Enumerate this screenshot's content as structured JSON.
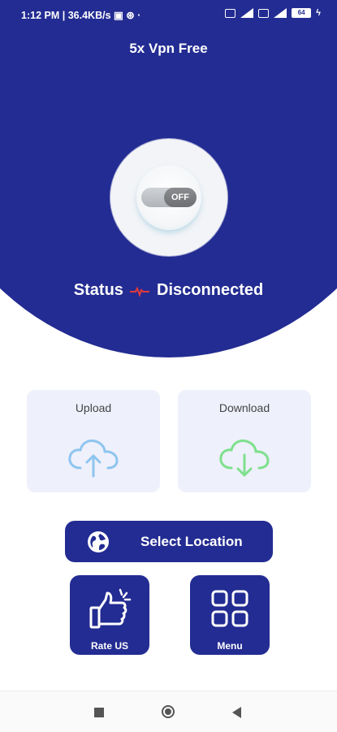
{
  "status_bar": {
    "time": "1:12 PM",
    "net_speed": "36.4KB/s",
    "battery": "64"
  },
  "app": {
    "title": "5x Vpn Free"
  },
  "vpn": {
    "toggle_label": "OFF",
    "status_label": "Status",
    "status_value": "Disconnected"
  },
  "stats": {
    "upload_label": "Upload",
    "download_label": "Download"
  },
  "actions": {
    "select_location": "Select Location",
    "rate_us": "Rate US",
    "menu": "Menu"
  },
  "colors": {
    "primary": "#232c92",
    "card_bg": "#eef0fb",
    "upload_icon": "#8ec5ef",
    "download_icon": "#7ee08d",
    "status_pulse": "#e23b3b"
  },
  "icons": {
    "upload": "cloud-upload-icon",
    "download": "cloud-download-icon",
    "location": "globe-icon",
    "rate": "thumbs-up-icon",
    "menu": "grid-icon"
  }
}
